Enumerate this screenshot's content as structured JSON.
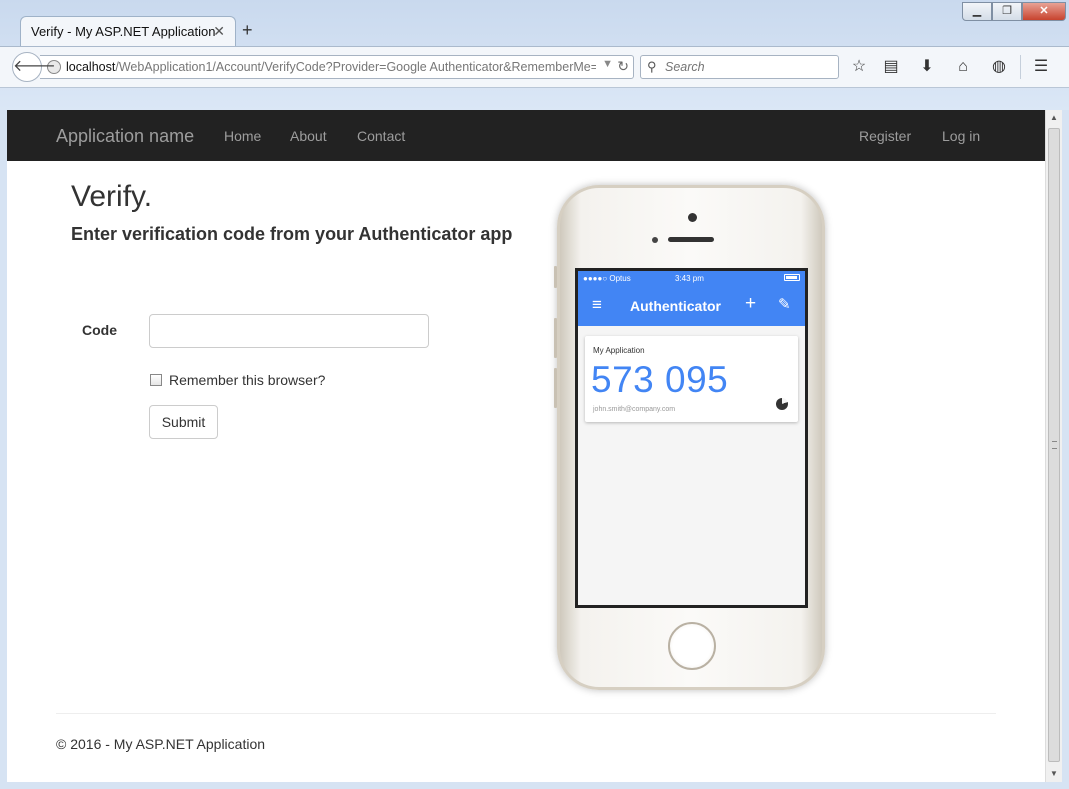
{
  "browser": {
    "tab_title": "Verify - My ASP.NET Application",
    "tab_close": "✕",
    "new_tab": "+",
    "window_controls": {
      "minimize": "▁",
      "restore": "❐",
      "close": "✕"
    },
    "url_host": "localhost",
    "url_path": "/WebApplication1/Account/VerifyCode?Provider=Google Authenticator&RememberMe=F",
    "search_placeholder": "Search",
    "toolbar_icons": [
      "star-icon",
      "reading-list-icon",
      "download-icon",
      "home-icon",
      "globe-icon",
      "menu-icon"
    ]
  },
  "site": {
    "brand": "Application name",
    "nav_left": [
      "Home",
      "About",
      "Contact"
    ],
    "nav_right": [
      "Register",
      "Log in"
    ]
  },
  "verify": {
    "title": "Verify.",
    "subtitle": "Enter verification code from your Authenticator app",
    "code_label": "Code",
    "code_value": "",
    "remember_label": "Remember this browser?",
    "remember_checked": false,
    "submit_label": "Submit"
  },
  "phone": {
    "carrier": "●●●●○ Optus",
    "time": "3:43 pm",
    "app_title": "Authenticator",
    "account_name": "My Application",
    "code": "573 095",
    "email": "john.smith@company.com",
    "accent_color": "#4285f4"
  },
  "footer": {
    "text": "© 2016 - My ASP.NET Application"
  },
  "colors": {
    "navbar_bg": "#222222",
    "navbar_text": "#9d9d9d",
    "page_bg": "#ffffff"
  }
}
